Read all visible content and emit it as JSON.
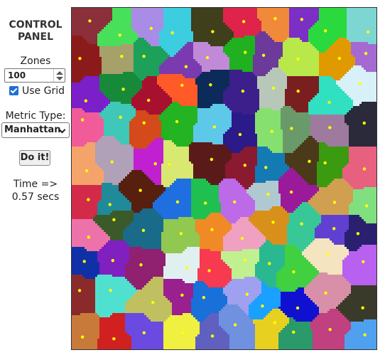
{
  "panel": {
    "title_line1": "CONTROL",
    "title_line2": "PANEL",
    "zones_label": "Zones",
    "zones_value": "100",
    "use_grid_label": "Use Grid",
    "use_grid_checked": true,
    "metric_label": "Metric Type:",
    "metric_selected": "Manhattan",
    "do_it_label": "Do it!",
    "time_line1": "Time =>",
    "time_line2": "0.57 secs"
  },
  "visualization": {
    "seed_color": "#ffff00",
    "zone_colors": [
      "#8b2f3b",
      "#48e05a",
      "#a98ce6",
      "#3ccde0",
      "#3f3f1b",
      "#e0234a",
      "#f08a3a",
      "#7c2fc4",
      "#2ad93d",
      "#7dd6d2",
      "#8b1b1b",
      "#a6a06a",
      "#1ca05a",
      "#7a3ab0",
      "#c08ad8",
      "#20b020",
      "#6b3a9a",
      "#b9e84b",
      "#e09a00",
      "#a46ad2",
      "#7b1fc9",
      "#178a3a",
      "#a81030",
      "#ff5a28",
      "#0c2a5a",
      "#3c1f8a",
      "#b8c8b8",
      "#7a1f1f",
      "#30e0c0",
      "#d8f0f8",
      "#f25b9a",
      "#3fc8b8",
      "#d44a1a",
      "#23b323",
      "#5ec8e8",
      "#2a1a8a",
      "#86e070",
      "#6a9a6a",
      "#9e7a9e",
      "#2a2a3a",
      "#f4a46a",
      "#b0a0b8",
      "#c020d0",
      "#d8e870",
      "#5a1a1a",
      "#8a1a30",
      "#147ab4",
      "#4a3a1a",
      "#3a9a10",
      "#e86080",
      "#d42a4a",
      "#1f8a9a",
      "#561f0e",
      "#1f6fe0",
      "#20c050",
      "#bc6ae8",
      "#b0c8d0",
      "#9a1a9a",
      "#d0a050",
      "#80e080",
      "#ee72aa",
      "#3a5a2a",
      "#1a6a8a",
      "#90c850",
      "#ef8a26",
      "#f0a0c0",
      "#d8901a",
      "#38c898",
      "#6040d0",
      "#2a2070",
      "#1030a8",
      "#8020c0",
      "#902070",
      "#e0f0f0",
      "#f83a50",
      "#c0f090",
      "#2ab890",
      "#40d040",
      "#f4e4c0",
      "#b860f0",
      "#8a2a2a",
      "#50e0d0",
      "#c0c060",
      "#9a2090",
      "#1870d8",
      "#a0a0f0",
      "#1aa0ff",
      "#1010d0",
      "#d890a8",
      "#3a3a2a",
      "#c87a3a",
      "#d02020",
      "#6a4ae0",
      "#f0f040",
      "#6060c0",
      "#7090e0",
      "#e8d020",
      "#2a9a6a",
      "#c04080",
      "#50a0f0"
    ]
  }
}
